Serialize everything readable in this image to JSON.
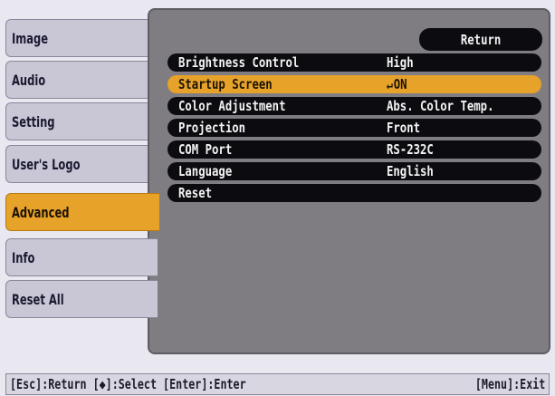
{
  "menu": {
    "items": [
      {
        "label": "Image"
      },
      {
        "label": "Audio"
      },
      {
        "label": "Setting"
      },
      {
        "label": "User's Logo"
      },
      {
        "label": "Advanced"
      },
      {
        "label": "Info"
      },
      {
        "label": "Reset All"
      }
    ],
    "active": "Advanced"
  },
  "panel": {
    "return_label": "Return",
    "settings": [
      {
        "label": "Brightness Control",
        "value": "High"
      },
      {
        "label": "Startup Screen",
        "value": "ON",
        "selected": true
      },
      {
        "label": "Color Adjustment",
        "value": "Abs. Color Temp."
      },
      {
        "label": "Projection",
        "value": "Front"
      },
      {
        "label": "COM Port",
        "value": "RS-232C"
      },
      {
        "label": "Language",
        "value": "English"
      },
      {
        "label": "Reset",
        "value": ""
      }
    ]
  },
  "status_bar": {
    "left": "[Esc]:Return [◆]:Select [Enter]:Enter",
    "right": "[Menu]:Exit"
  },
  "colors": {
    "accent": "#e7a22a",
    "panel": "#7f7d82",
    "bar": "#0c0b10",
    "tab": "#c9c6d6"
  },
  "icons": {
    "enter": "enter-icon"
  }
}
